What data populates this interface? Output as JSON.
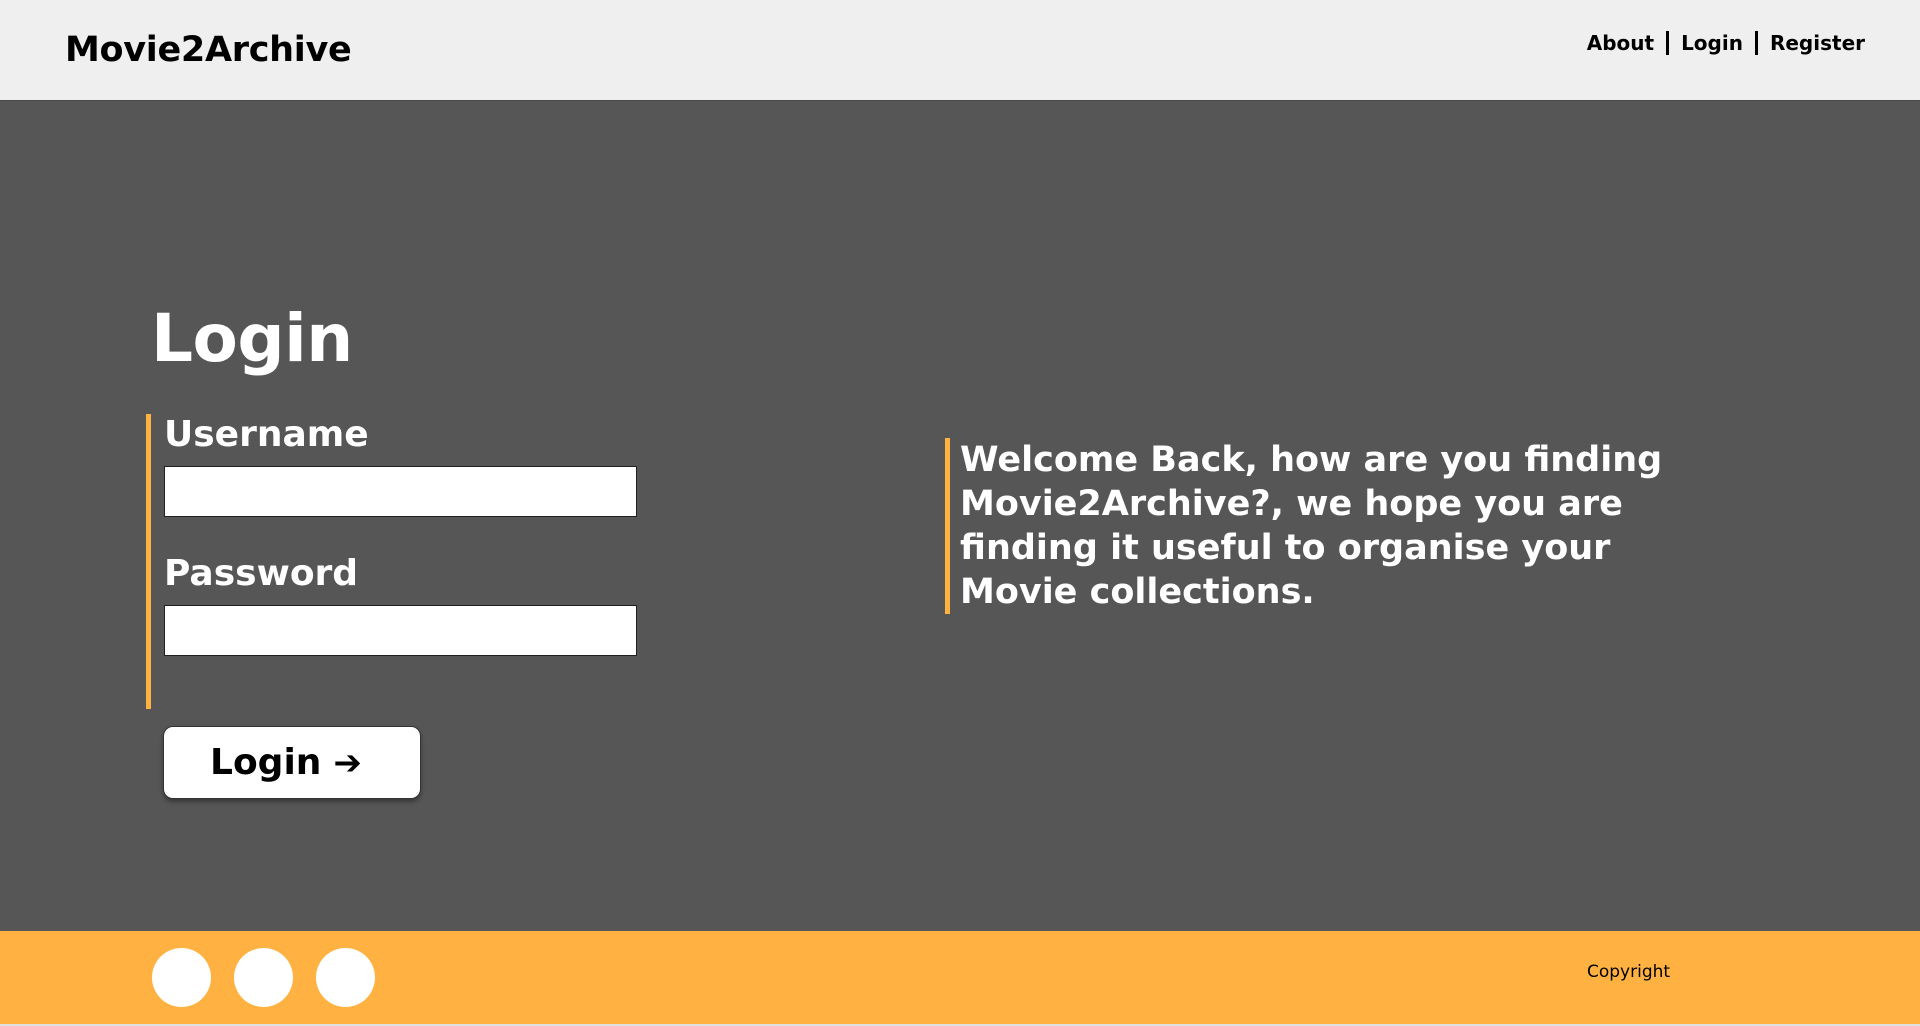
{
  "header": {
    "brand": "Movie2Archive",
    "nav": [
      {
        "label": "About"
      },
      {
        "label": "Login"
      },
      {
        "label": "Register"
      }
    ]
  },
  "main": {
    "title": "Login",
    "form": {
      "username_label": "Username",
      "username_value": "",
      "password_label": "Password",
      "password_value": "",
      "submit_label": "Login",
      "submit_icon": "arrow-right-icon"
    },
    "welcome": "Welcome Back, how are you finding Movie2Archive?, we hope you are finding it useful to organise your Movie collections."
  },
  "footer": {
    "social_icons": [
      "social-icon-1",
      "social-icon-2",
      "social-icon-3"
    ],
    "copyright": "Copyright"
  },
  "colors": {
    "accent": "#ffb241",
    "main_bg": "#565656",
    "header_bg": "#efefef"
  }
}
